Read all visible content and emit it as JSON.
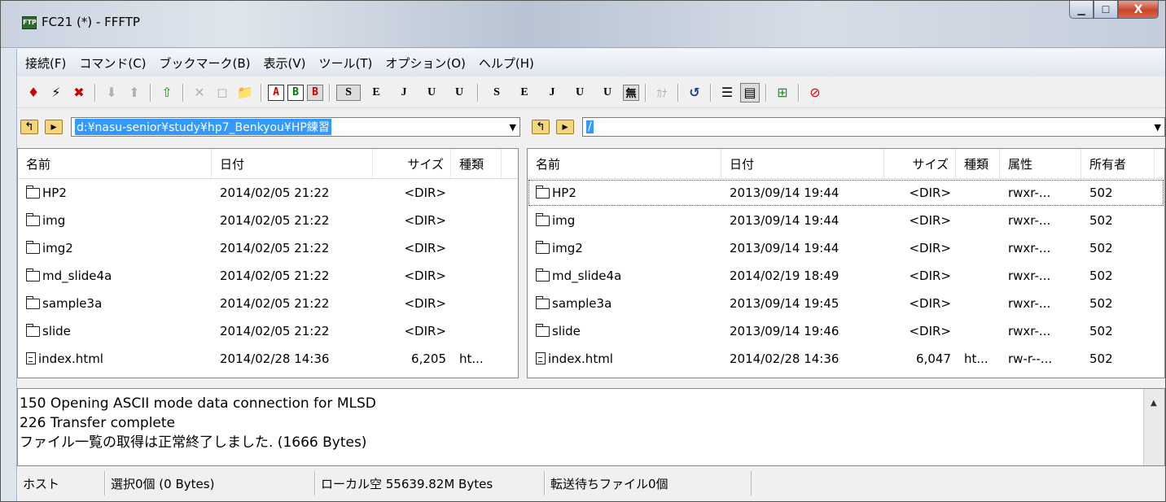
{
  "window": {
    "title": "FC21 (*) - FFFTP",
    "app_icon_text": "FTP",
    "min_glyph": "▁",
    "max_glyph": "☐",
    "close_glyph": "X"
  },
  "menu": [
    "接続(F)",
    "コマンド(C)",
    "ブックマーク(B)",
    "表示(V)",
    "ツール(T)",
    "オプション(O)",
    "ヘルプ(H)"
  ],
  "toolbar": {
    "code_buttons": [
      "S",
      "E",
      "J",
      "U",
      "U",
      "S",
      "E",
      "J",
      "U",
      "U"
    ],
    "ascii_label": "A",
    "binary_label": "B",
    "auto_label": "B",
    "no_convert_label": "無",
    "kana_label": "ｶﾅ"
  },
  "left_path": "d:¥nasu-senior¥study¥hp7_Benkyou¥HP練習",
  "right_path": "/",
  "left_pane": {
    "headers": [
      "名前",
      "日付",
      "サイズ",
      "種類"
    ],
    "rows": [
      {
        "type": "folder",
        "name": "HP2",
        "date": "2014/02/05 21:22",
        "size": "<DIR>",
        "kind": ""
      },
      {
        "type": "folder",
        "name": "img",
        "date": "2014/02/05 21:22",
        "size": "<DIR>",
        "kind": ""
      },
      {
        "type": "folder",
        "name": "img2",
        "date": "2014/02/05 21:22",
        "size": "<DIR>",
        "kind": ""
      },
      {
        "type": "folder",
        "name": "md_slide4a",
        "date": "2014/02/05 21:22",
        "size": "<DIR>",
        "kind": ""
      },
      {
        "type": "folder",
        "name": "sample3a",
        "date": "2014/02/05 21:22",
        "size": "<DIR>",
        "kind": ""
      },
      {
        "type": "folder",
        "name": "slide",
        "date": "2014/02/05 21:22",
        "size": "<DIR>",
        "kind": ""
      },
      {
        "type": "file",
        "name": "index.html",
        "date": "2014/02/28 14:36",
        "size": "6,205",
        "kind": "ht..."
      }
    ]
  },
  "right_pane": {
    "headers": [
      "名前",
      "日付",
      "サイズ",
      "種類",
      "属性",
      "所有者"
    ],
    "rows": [
      {
        "type": "folder",
        "name": "HP2",
        "date": "2013/09/14 19:44",
        "size": "<DIR>",
        "kind": "",
        "attr": "rwxr-...",
        "owner": "502"
      },
      {
        "type": "folder",
        "name": "img",
        "date": "2013/09/14 19:44",
        "size": "<DIR>",
        "kind": "",
        "attr": "rwxr-...",
        "owner": "502"
      },
      {
        "type": "folder",
        "name": "img2",
        "date": "2013/09/14 19:44",
        "size": "<DIR>",
        "kind": "",
        "attr": "rwxr-...",
        "owner": "502"
      },
      {
        "type": "folder",
        "name": "md_slide4a",
        "date": "2014/02/19 18:49",
        "size": "<DIR>",
        "kind": "",
        "attr": "rwxr-...",
        "owner": "502"
      },
      {
        "type": "folder",
        "name": "sample3a",
        "date": "2013/09/14 19:45",
        "size": "<DIR>",
        "kind": "",
        "attr": "rwxr-...",
        "owner": "502"
      },
      {
        "type": "folder",
        "name": "slide",
        "date": "2013/09/14 19:46",
        "size": "<DIR>",
        "kind": "",
        "attr": "rwxr-...",
        "owner": "502"
      },
      {
        "type": "file",
        "name": "index.html",
        "date": "2014/02/28 14:36",
        "size": "6,047",
        "kind": "ht...",
        "attr": "rw-r--...",
        "owner": "502"
      }
    ]
  },
  "log": [
    "150 Opening ASCII mode data connection for MLSD",
    "226 Transfer complete",
    "ファイル一覧の取得は正常終了しました. (1666 Bytes)"
  ],
  "status": {
    "host": "ホスト",
    "selection": "選択0個 (0 Bytes)",
    "local_free": "ローカル空 55639.82M Bytes",
    "queue": "転送待ちファイル0個"
  }
}
